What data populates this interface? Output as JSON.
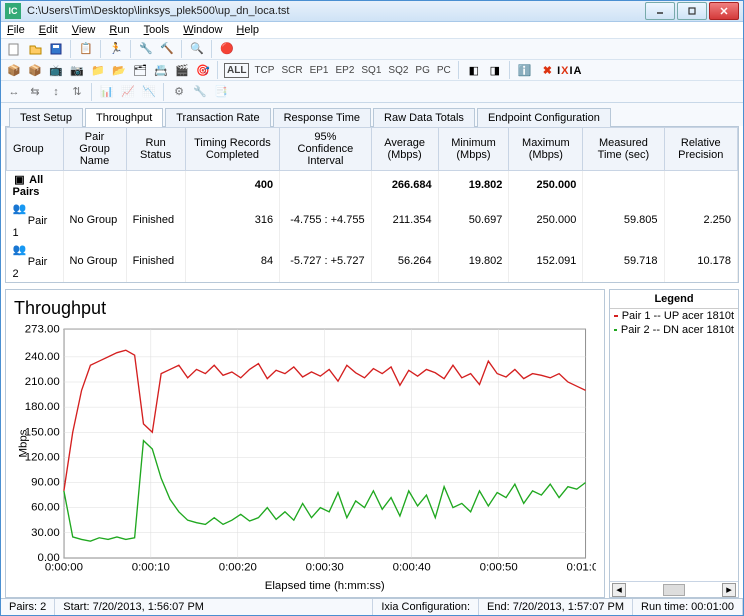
{
  "window": {
    "title": "C:\\Users\\Tim\\Desktop\\linksys_plek500\\up_dn_loca.tst",
    "app_abbr": "IC"
  },
  "menus": [
    "File",
    "Edit",
    "View",
    "Run",
    "Tools",
    "Window",
    "Help"
  ],
  "toolbar2_labels": {
    "all": "ALL",
    "tcp": "TCP",
    "scr": "SCR",
    "ep1": "EP1",
    "ep2": "EP2",
    "sq1": "SQ1",
    "sq2": "SQ2",
    "pg": "PG",
    "pc": "PC"
  },
  "brand": {
    "pre": "I",
    "x": "X",
    "post": "IA"
  },
  "tabs": [
    "Test Setup",
    "Throughput",
    "Transaction Rate",
    "Response Time",
    "Raw Data Totals",
    "Endpoint Configuration"
  ],
  "active_tab": 1,
  "table": {
    "headers": [
      "Group",
      "Pair Group Name",
      "Run Status",
      "Timing Records Completed",
      "95% Confidence Interval",
      "Average (Mbps)",
      "Minimum (Mbps)",
      "Maximum (Mbps)",
      "Measured Time (sec)",
      "Relative Precision"
    ],
    "summary": {
      "label": "All Pairs",
      "timing": "400",
      "avg": "266.684",
      "min": "19.802",
      "max": "250.000"
    },
    "rows": [
      {
        "group": "Pair 1",
        "pg": "No Group",
        "status": "Finished",
        "timing": "316",
        "ci": "-4.755 : +4.755",
        "avg": "211.354",
        "min": "50.697",
        "max": "250.000",
        "time": "59.805",
        "prec": "2.250"
      },
      {
        "group": "Pair 2",
        "pg": "No Group",
        "status": "Finished",
        "timing": "84",
        "ci": "-5.727 : +5.727",
        "avg": "56.264",
        "min": "19.802",
        "max": "152.091",
        "time": "59.718",
        "prec": "10.178"
      }
    ]
  },
  "chart_data": {
    "type": "line",
    "title": "Throughput",
    "ylabel": "Mbps",
    "xlabel": "Elapsed time (h:mm:ss)",
    "ylim": [
      0,
      273
    ],
    "yticks": [
      0,
      30,
      60,
      90,
      120,
      150,
      180,
      210,
      240,
      273
    ],
    "xticks": [
      "0:00:00",
      "0:00:10",
      "0:00:20",
      "0:00:30",
      "0:00:40",
      "0:00:50",
      "0:01:00"
    ],
    "series": [
      {
        "name": "Pair 1 -- UP acer 1810t",
        "color": "#d42020",
        "values": [
          80,
          150,
          200,
          230,
          235,
          240,
          245,
          248,
          242,
          160,
          150,
          220,
          225,
          230,
          215,
          225,
          220,
          230,
          218,
          222,
          215,
          225,
          232,
          214,
          224,
          220,
          228,
          216,
          222,
          217,
          225,
          211,
          230,
          221,
          215,
          226,
          220,
          228,
          206,
          224,
          217,
          225,
          221,
          214,
          230,
          215,
          220,
          207,
          235,
          220,
          216,
          225,
          214,
          220,
          218,
          215,
          220,
          210,
          205,
          200
        ]
      },
      {
        "name": "Pair 2 -- DN acer 1810t",
        "color": "#20a820",
        "values": [
          80,
          25,
          22,
          20,
          24,
          22,
          25,
          22,
          24,
          140,
          130,
          95,
          70,
          55,
          45,
          42,
          40,
          48,
          40,
          45,
          52,
          44,
          48,
          60,
          46,
          55,
          45,
          65,
          48,
          60,
          55,
          78,
          48,
          68,
          60,
          80,
          58,
          72,
          50,
          80,
          62,
          75,
          48,
          85,
          60,
          65,
          55,
          80,
          62,
          78,
          72,
          88,
          65,
          80,
          75,
          88,
          72,
          85,
          82,
          90
        ]
      }
    ]
  },
  "legend": {
    "title": "Legend"
  },
  "status": {
    "pairs": "Pairs: 2",
    "start": "Start: 7/20/2013, 1:56:07 PM",
    "ixia": "Ixia Configuration:",
    "end": "End: 7/20/2013, 1:57:07 PM",
    "run": "Run time: 00:01:00"
  }
}
